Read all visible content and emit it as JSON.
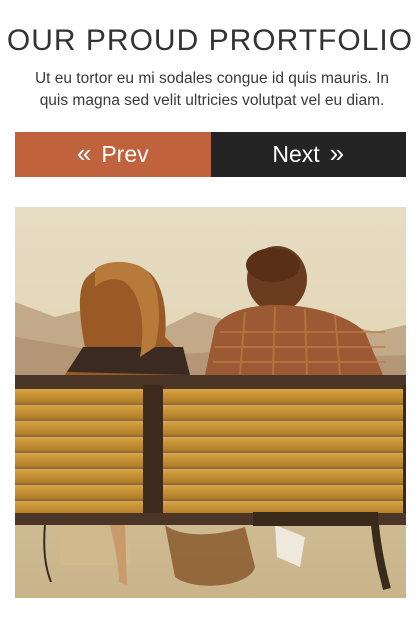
{
  "portfolio": {
    "title": "OUR PROUD PRORTFOLIO",
    "description": "Ut eu tortor eu mi sodales congue id quis mauris. In quis magna sed velit ultricies volutpat vel eu diam."
  },
  "navigation": {
    "prev_icon": "double-chevron-left-icon",
    "prev_label": "Prev",
    "next_label": "Next",
    "next_icon": "double-chevron-right-icon",
    "prev_color": "#c0633c",
    "next_color": "#242424"
  },
  "gallery": {
    "current_image": "couple-on-bench-photo"
  }
}
